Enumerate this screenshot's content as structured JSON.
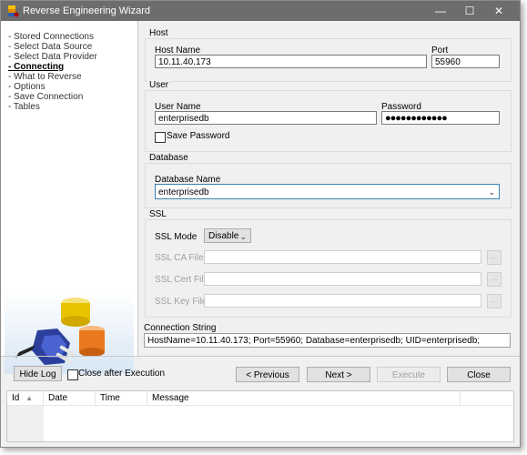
{
  "window": {
    "title": "Reverse Engineering Wizard"
  },
  "sidebar": {
    "items": [
      {
        "label": "- Stored Connections",
        "active": false
      },
      {
        "label": "- Select Data Source",
        "active": false
      },
      {
        "label": "- Select Data Provider",
        "active": false
      },
      {
        "label": "- Connecting",
        "active": true
      },
      {
        "label": "- What to Reverse",
        "active": false
      },
      {
        "label": "- Options",
        "active": false
      },
      {
        "label": "- Save Connection",
        "active": false
      },
      {
        "label": "- Tables",
        "active": false
      }
    ]
  },
  "host": {
    "group_title": "Host",
    "host_name_label": "Host Name",
    "host_name_value": "10.11.40.173",
    "port_label": "Port",
    "port_value": "55960"
  },
  "user": {
    "group_title": "User",
    "user_name_label": "User Name",
    "user_name_value": "enterprisedb",
    "password_label": "Password",
    "password_value": "●●●●●●●●●●●●",
    "save_password_label": "Save Password"
  },
  "database": {
    "group_title": "Database",
    "database_name_label": "Database Name",
    "database_name_value": "enterprisedb"
  },
  "ssl": {
    "group_title": "SSL",
    "mode_label": "SSL Mode",
    "mode_value": "Disable",
    "ca_label": "SSL CA File",
    "cert_label": "SSL Cert File",
    "key_label": "SSL Key File",
    "browse_label": "..."
  },
  "connection": {
    "label": "Connection String",
    "value": "HostName=10.11.40.173; Port=55960; Database=enterprisedb; UID=enterprisedb;"
  },
  "buttons": {
    "hide_log": "Hide Log",
    "close_after_execution": "Close after Execution",
    "previous": "< Previous",
    "next": "Next >",
    "execute": "Execute",
    "close": "Close"
  },
  "log": {
    "columns": [
      "Id",
      "Date",
      "Time",
      "Message"
    ]
  },
  "colors": {
    "titlebar": "#6d6d6d",
    "focus_border": "#3c7fb1",
    "panel": "#f0f0f0"
  }
}
